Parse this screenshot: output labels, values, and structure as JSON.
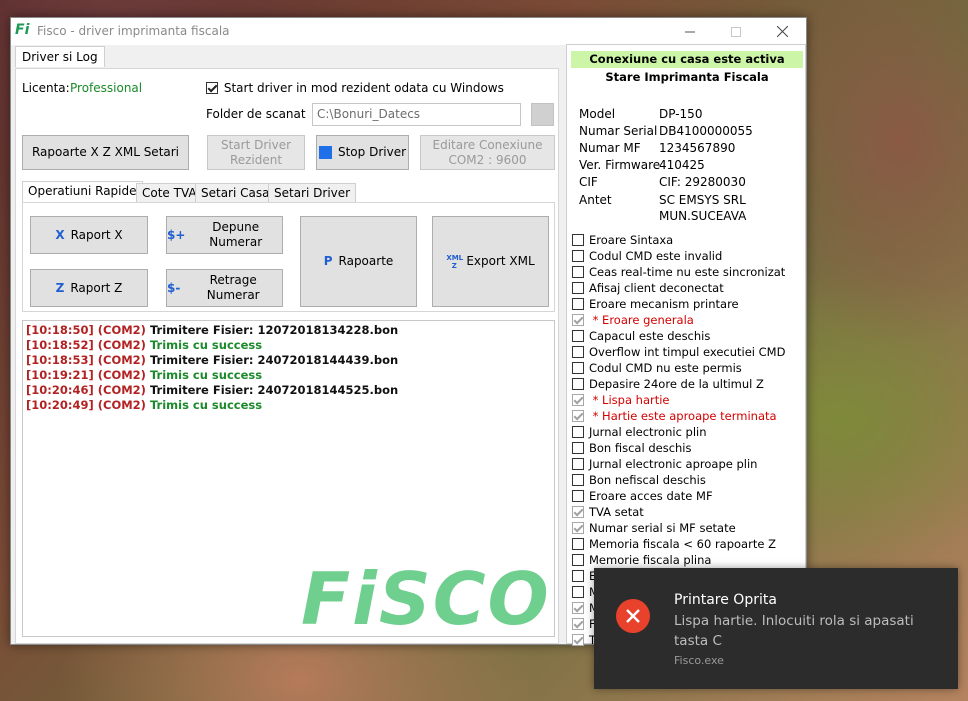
{
  "window": {
    "app_logo": "Fi",
    "title": "Fisco - driver imprimanta fiscala"
  },
  "main_tab": {
    "label": "Driver si Log"
  },
  "license": {
    "label": "Licenta:",
    "value": "Professional"
  },
  "start_resident": {
    "label": "Start driver in mod rezident odata cu Windows",
    "checked": true
  },
  "scan_folder": {
    "label": "Folder de scanat",
    "value": "C:\\Bonuri_Datecs"
  },
  "buttons": {
    "reports_setup": "Rapoarte X Z  XML  Setari",
    "start_driver_line1": "Start Driver",
    "start_driver_line2": "Rezident",
    "stop_driver": "Stop Driver",
    "edit_conn_line1": "Editare Conexiune",
    "edit_conn_line2": "COM2 : 9600"
  },
  "sub_tabs": [
    "Operatiuni Rapide",
    "Cote TVA",
    "Setari Casa",
    "Setari Driver"
  ],
  "quick_ops": {
    "raport_x": {
      "icon": "X",
      "label": "Raport X"
    },
    "raport_z": {
      "icon": "Z",
      "label": "Raport Z"
    },
    "depune": {
      "icon": "$+",
      "label": "Depune Numerar"
    },
    "retrage": {
      "icon": "$-",
      "label": "Retrage Numerar"
    },
    "rapoarte": {
      "icon": "P",
      "label": "Rapoarte"
    },
    "export_xml": {
      "icon": "XML Z",
      "label": "Export XML"
    }
  },
  "log": [
    {
      "time": "[10:18:50]",
      "port": "(COM2)",
      "msg": "Trimitere Fisier: 12072018134228.bon",
      "kind": "dark"
    },
    {
      "time": "[10:18:52]",
      "port": "(COM2)",
      "msg": "Trimis cu success",
      "kind": "ok"
    },
    {
      "time": "[10:18:53]",
      "port": "(COM2)",
      "msg": "Trimitere Fisier: 24072018144439.bon",
      "kind": "dark"
    },
    {
      "time": "[10:19:21]",
      "port": "(COM2)",
      "msg": "Trimis cu success",
      "kind": "ok"
    },
    {
      "time": "[10:20:46]",
      "port": "(COM2)",
      "msg": "Trimitere Fisier: 24072018144525.bon",
      "kind": "dark"
    },
    {
      "time": "[10:20:49]",
      "port": "(COM2)",
      "msg": "Trimis cu success",
      "kind": "ok"
    }
  ],
  "watermark": "FiSCO",
  "status_panel": {
    "connection": "Conexiune cu casa este activa",
    "title": "Stare Imprimanta Fiscala",
    "info": [
      {
        "label": "Model",
        "value": "DP-150"
      },
      {
        "label": "Numar Serial",
        "value": "DB4100000055"
      },
      {
        "label": "Numar MF",
        "value": "1234567890"
      },
      {
        "label": "Ver. Firmware",
        "value": "410425"
      },
      {
        "label": "CIF",
        "value": "CIF: 29280030"
      },
      {
        "label": "Antet",
        "value": "SC EMSYS SRL"
      },
      {
        "label": "",
        "value": "MUN.SUCEAVA"
      }
    ],
    "flags": [
      {
        "text": "Eroare Sintaxa",
        "checked": false,
        "error": false
      },
      {
        "text": "Codul CMD este invalid",
        "checked": false,
        "error": false
      },
      {
        "text": "Ceas real-time nu este sincronizat",
        "checked": false,
        "error": false
      },
      {
        "text": "Afisaj client deconectat",
        "checked": false,
        "error": false
      },
      {
        "text": "Eroare mecanism printare",
        "checked": false,
        "error": false
      },
      {
        "text": " * Eroare generala",
        "checked": true,
        "error": true
      },
      {
        "text": "Capacul este deschis",
        "checked": false,
        "error": false
      },
      {
        "text": "Overflow int timpul executiei CMD",
        "checked": false,
        "error": false
      },
      {
        "text": "Codul CMD nu este permis",
        "checked": false,
        "error": false
      },
      {
        "text": "Depasire 24ore de la ultimul Z",
        "checked": false,
        "error": false
      },
      {
        "text": " * Lispa hartie",
        "checked": true,
        "error": true
      },
      {
        "text": " * Hartie este aproape terminata",
        "checked": true,
        "error": true
      },
      {
        "text": "Jurnal electronic plin",
        "checked": false,
        "error": false
      },
      {
        "text": "Bon fiscal deschis",
        "checked": false,
        "error": false
      },
      {
        "text": "Jurnal electronic aproape plin",
        "checked": false,
        "error": false
      },
      {
        "text": "Bon nefiscal deschis",
        "checked": false,
        "error": false
      },
      {
        "text": "Eroare acces date MF",
        "checked": false,
        "error": false
      },
      {
        "text": "TVA setat",
        "checked": true,
        "error": false
      },
      {
        "text": "Numar serial si MF setate",
        "checked": true,
        "error": false
      },
      {
        "text": "Memoria fiscala < 60 rapoarte Z",
        "checked": false,
        "error": false
      },
      {
        "text": "Memorie fiscala plina",
        "checked": false,
        "error": false
      },
      {
        "text": "Eroare generala memorie fiscala",
        "checked": false,
        "error": false
      },
      {
        "text": "M",
        "checked": false,
        "error": false
      },
      {
        "text": "M",
        "checked": true,
        "error": false
      },
      {
        "text": "F",
        "checked": true,
        "error": false
      },
      {
        "text": "T",
        "checked": true,
        "error": false
      }
    ]
  },
  "toast": {
    "title": "Printare Oprita",
    "body": "Lispa hartie. Inlocuiti rola si apasati tasta C",
    "source": "Fisco.exe"
  }
}
